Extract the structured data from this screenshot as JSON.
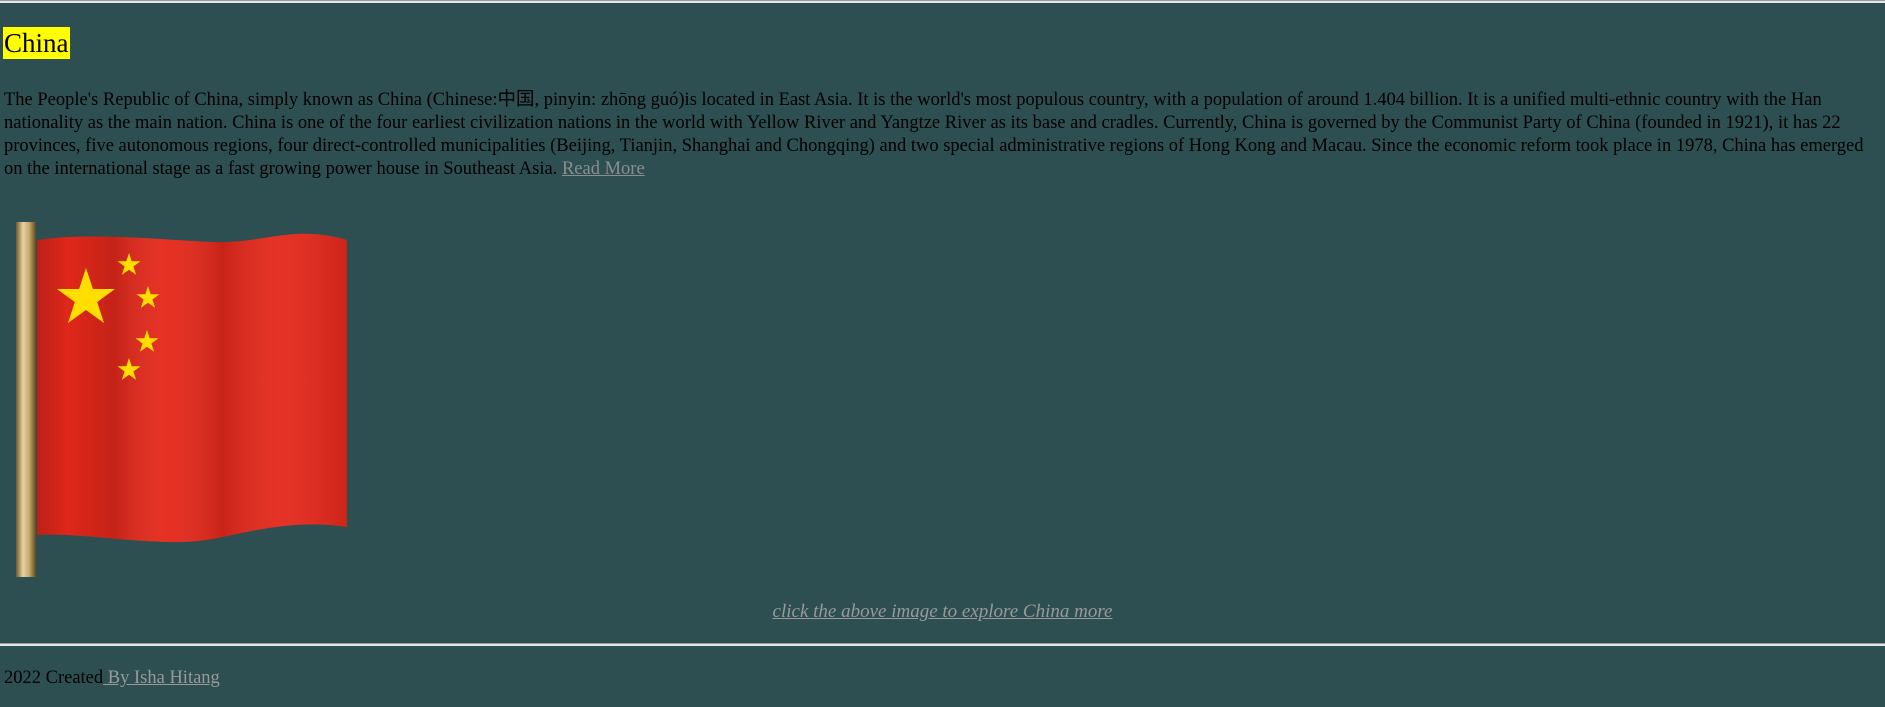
{
  "page": {
    "title": "China",
    "intro": "The People's Republic of China, simply known as China (Chinese:中国, pinyin: zhōng guó)is located in East Asia. It is the world's most populous country, with a population of around 1.404 billion. It is a unified multi-ethnic country with the Han nationality as the main nation. China is one of the four earliest civilization nations in the world with Yellow River and Yangtze River as its base and cradles. Currently, China is governed by the Communist Party of China (founded in 1921), it has 22 provinces, five autonomous regions, four direct-controlled municipalities (Beijing, Tianjin, Shanghai and Chongqing) and two special administrative regions of Hong Kong and Macau. Since the economic reform took place in 1978, China has emerged on the international stage as a fast growing power house in Southeast Asia.",
    "read_more": "Read More"
  },
  "image": {
    "subject": "flag-of-china",
    "colors": {
      "field": "#e4281b",
      "stars": "#ffde00",
      "pole": "#b89a5c"
    }
  },
  "caption": "click the above image to explore China more",
  "footer": {
    "prefix": "2022 Created",
    "author_link": " By Isha Hitang"
  },
  "theme": {
    "background": "#2e4f51",
    "title_highlight": "#ffff00",
    "link_color": "#999999"
  }
}
